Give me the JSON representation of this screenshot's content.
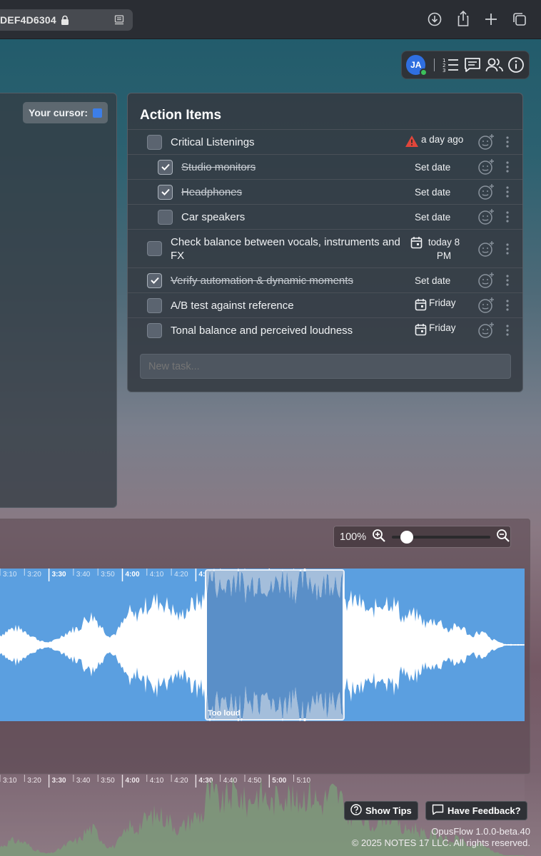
{
  "browser": {
    "url_fragment": "DEF4D6304",
    "icons": [
      "lock-icon",
      "reader-icon",
      "download-icon",
      "share-icon",
      "new-tab-icon",
      "tabs-overview-icon"
    ]
  },
  "presence": {
    "avatar_initials": "JA",
    "online_color": "#3cc15b",
    "buttons": [
      "numbered-list-icon",
      "comments-icon",
      "people-icon",
      "info-icon"
    ]
  },
  "left_panel": {
    "cursor_label": "Your cursor:",
    "cursor_color": "#3c7ee8"
  },
  "action_items": {
    "title": "Action Items",
    "new_task_placeholder": "New task...",
    "tasks": [
      {
        "label": "Critical Listenings",
        "done": false,
        "indent": 0,
        "due": "a day ago",
        "due_icon": "warning-icon"
      },
      {
        "label": "Studio monitors",
        "done": true,
        "indent": 1,
        "due": "Set date",
        "due_icon": ""
      },
      {
        "label": "Headphones",
        "done": true,
        "indent": 1,
        "due": "Set date",
        "due_icon": ""
      },
      {
        "label": "Car speakers",
        "done": false,
        "indent": 1,
        "due": "Set date",
        "due_icon": ""
      },
      {
        "label": "Check balance between vocals, instruments and FX",
        "done": false,
        "indent": 0,
        "due": "today 8 PM",
        "due_icon": "calendar-icon"
      },
      {
        "label": "Verify automation & dynamic moments",
        "done": true,
        "indent": 0,
        "due": "Set date",
        "due_icon": ""
      },
      {
        "label": "A/B test against reference",
        "done": false,
        "indent": 0,
        "due": "Friday",
        "due_icon": "calendar-icon"
      },
      {
        "label": "Tonal balance and perceived loudness",
        "done": false,
        "indent": 0,
        "due": "Friday",
        "due_icon": "calendar-icon"
      }
    ]
  },
  "waveform": {
    "zoom_label": "100%",
    "zoom_fraction": 0.1,
    "time_ticks": [
      "3:10",
      "3:20",
      "3:30",
      "3:40",
      "3:50",
      "4:00",
      "4:10",
      "4:20",
      "4:30",
      "4:40",
      "4:50",
      "5:00",
      "5:10"
    ],
    "major_ticks": [
      "3:30",
      "4:00",
      "4:30",
      "5:00"
    ],
    "region_label": "Too loud",
    "wave_color": "#5b9fe0",
    "region_color": "#a4bedb",
    "lower_wave_color": "#7d9a7a"
  },
  "footer": {
    "show_tips": "Show Tips",
    "feedback": "Have Feedback?",
    "version": "OpusFlow 1.0.0-beta.40",
    "copyright": "© 2025 NOTES 17 LLC. All rights reserved."
  }
}
